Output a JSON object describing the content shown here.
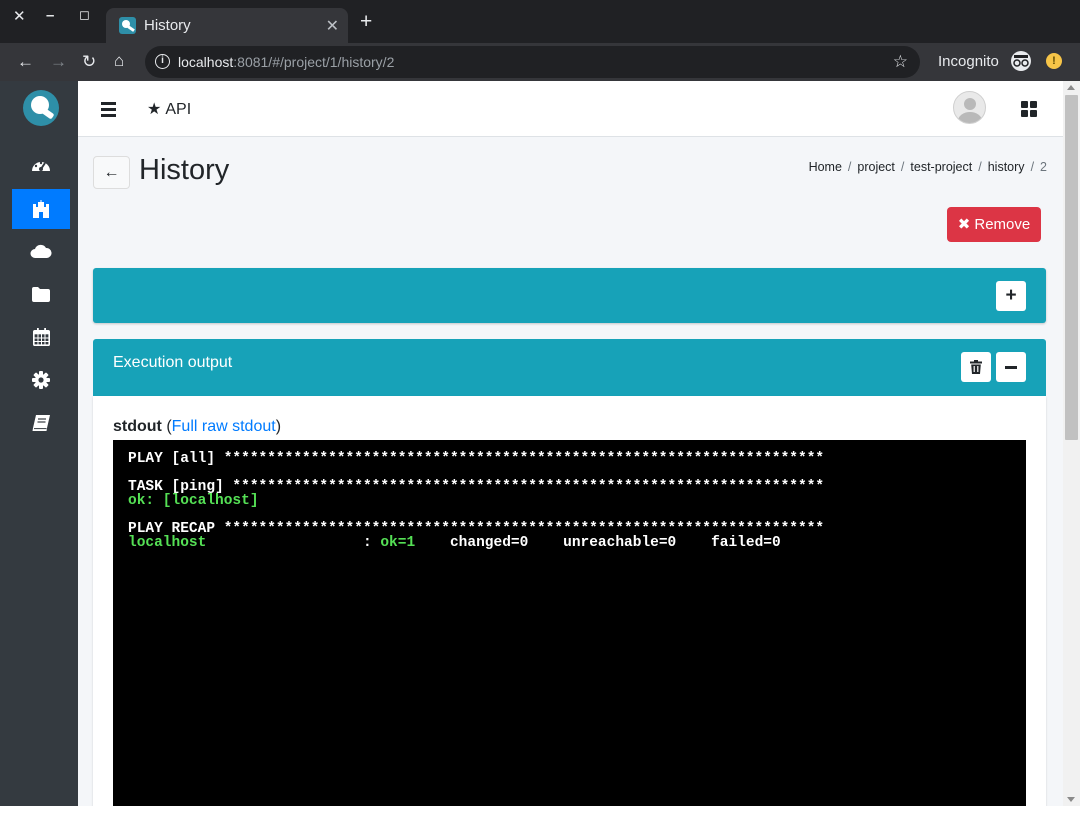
{
  "browser": {
    "tab_title": "History",
    "url_host": "localhost",
    "url_path": ":8081/#/project/1/history/2",
    "incognito_label": "Incognito"
  },
  "navbar": {
    "api_label": "API"
  },
  "sidebar": {
    "items": [
      {
        "name": "dashboard",
        "icon": "tachometer-icon",
        "active": false
      },
      {
        "name": "projects",
        "icon": "castle-icon",
        "active": true
      },
      {
        "name": "cloud",
        "icon": "cloud-icon",
        "active": false
      },
      {
        "name": "files",
        "icon": "folder-icon",
        "active": false
      },
      {
        "name": "calendar",
        "icon": "calendar-icon",
        "active": false
      },
      {
        "name": "settings",
        "icon": "gear-icon",
        "active": false
      },
      {
        "name": "docs",
        "icon": "book-icon",
        "active": false
      }
    ]
  },
  "page": {
    "title": "History",
    "breadcrumb": [
      "Home",
      "project",
      "test-project",
      "history",
      "2"
    ],
    "remove_label": "Remove"
  },
  "output_card": {
    "title": "Execution output",
    "stdout_label": "stdout",
    "raw_link_label": "Full raw stdout",
    "console_lines": [
      {
        "text": "PLAY [all] *********************************************************************",
        "color": "#ffffff"
      },
      {
        "text": "",
        "color": "#ffffff"
      },
      {
        "text": "TASK [ping] ********************************************************************",
        "color": "#ffffff"
      },
      {
        "text": "ok: [localhost]",
        "color": "#55e055"
      },
      {
        "text": "",
        "color": "#ffffff"
      },
      {
        "text": "PLAY RECAP *********************************************************************",
        "color": "#ffffff"
      }
    ],
    "recap": {
      "host": "localhost",
      "ok": "ok=1",
      "changed": "changed=0",
      "unreachable": "unreachable=0",
      "failed": "failed=0"
    }
  },
  "colors": {
    "accent": "#17a2b8",
    "danger": "#dc3545",
    "active_nav": "#007bff",
    "sidebar_bg": "#343a40"
  }
}
